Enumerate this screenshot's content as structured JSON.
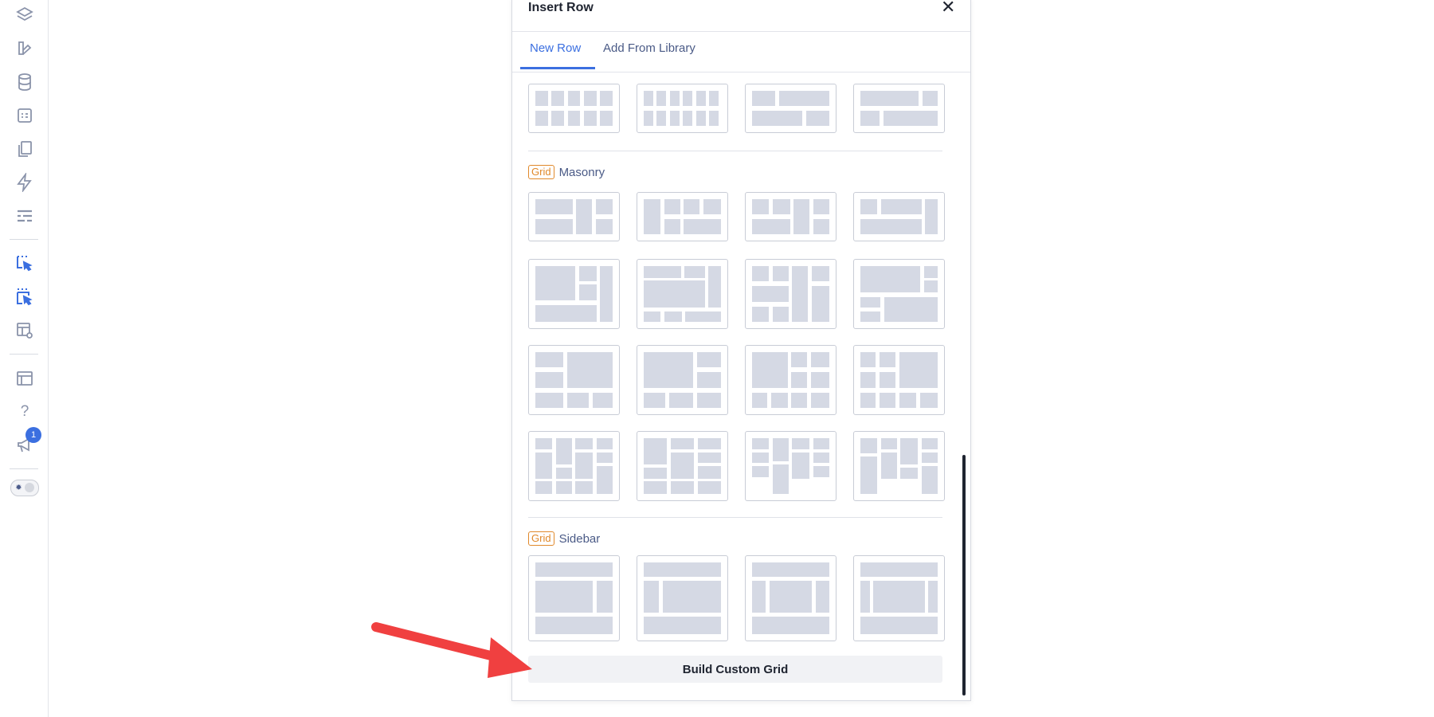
{
  "sidebar": {
    "icons": [
      "layers-icon",
      "brush-icon",
      "database-icon",
      "form-icon",
      "copy-icon",
      "bolt-icon",
      "list-icon",
      "select-pointer-icon",
      "multi-select-pointer-icon",
      "layout-preview-icon",
      "window-icon",
      "help-icon",
      "megaphone-icon"
    ],
    "help_glyph": "?",
    "notification_count": "1"
  },
  "dialog": {
    "title": "Insert Row",
    "close_glyph": "✕",
    "tabs": [
      {
        "label": "New Row",
        "active": true
      },
      {
        "label": "Add From Library",
        "active": false
      }
    ],
    "sections": [
      {
        "tag": "Grid",
        "title": "Masonry"
      },
      {
        "tag": "Grid",
        "title": "Sidebar"
      }
    ],
    "build_button": "Build Custom Grid"
  },
  "colors": {
    "accent": "#3b6fe0",
    "tag": "#e0892b",
    "cell": "#d5d9e4",
    "arrow": "#f04040"
  }
}
